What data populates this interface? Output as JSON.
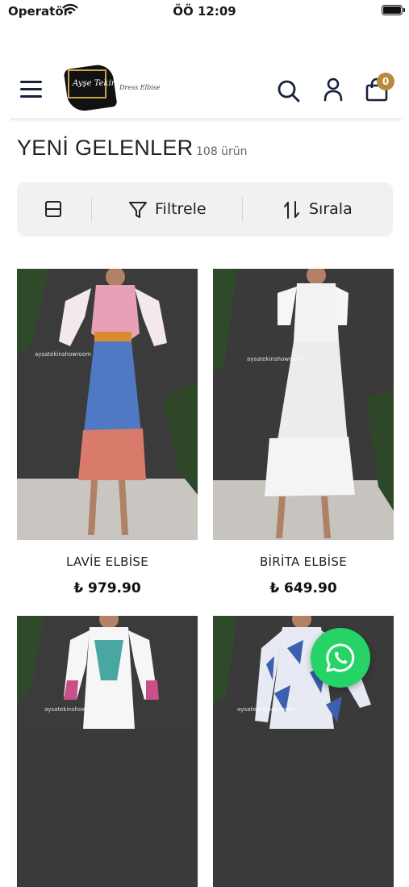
{
  "status_bar": {
    "carrier": "Operatör",
    "time": "ÖÖ 12:09"
  },
  "header": {
    "logo_script": "Ayşe Tekin",
    "logo_tagline": "Dress Elbise",
    "cart_count": "0",
    "icons": [
      "menu-icon",
      "search-icon",
      "user-icon",
      "shopping-bag-icon"
    ]
  },
  "page": {
    "title": "YENİ GELENLER",
    "product_count": "108 ürün"
  },
  "toolbar": {
    "filter_label": "Filtrele",
    "sort_label": "Sırala",
    "icons": [
      "grid-layout-icon",
      "filter-icon",
      "sort-icon"
    ]
  },
  "products": [
    {
      "name": "LAVİE ELBİSE",
      "price": "₺ 979.90",
      "watermark": "aysatekinshowroom"
    },
    {
      "name": "BİRİTA ELBİSE",
      "price": "₺ 649.90",
      "watermark": "aysatekinshowroom"
    },
    {
      "name": "",
      "price": "",
      "watermark": "aysatekinshowroom"
    },
    {
      "name": "",
      "price": "",
      "watermark": "aysatekinshowroom"
    }
  ],
  "whatsapp": {
    "icon": "whatsapp-icon"
  },
  "colors": {
    "navy": "#16213e",
    "gold": "#b68b3b",
    "whatsapp": "#25d366",
    "toolbar_bg": "#f1f1f1"
  }
}
